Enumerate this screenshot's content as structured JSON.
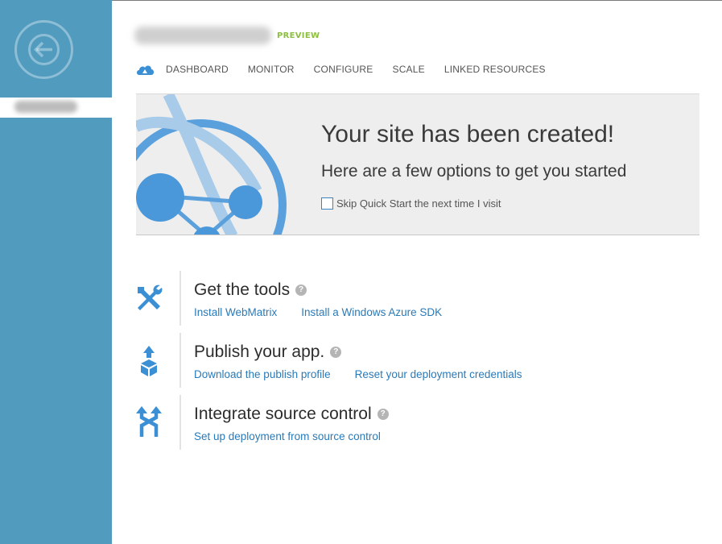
{
  "header": {
    "preview_badge": "PREVIEW"
  },
  "tabs": [
    {
      "label": "DASHBOARD"
    },
    {
      "label": "MONITOR"
    },
    {
      "label": "CONFIGURE"
    },
    {
      "label": "SCALE"
    },
    {
      "label": "LINKED RESOURCES"
    }
  ],
  "banner": {
    "title": "Your site has been created!",
    "subtitle": "Here are a few options to get you started",
    "skip_label": "Skip Quick Start the next time I visit",
    "skip_checked": false
  },
  "sections": [
    {
      "title": "Get the tools",
      "icon": "tools-icon",
      "links": [
        "Install WebMatrix",
        "Install a Windows Azure SDK"
      ]
    },
    {
      "title": "Publish your app.",
      "icon": "publish-icon",
      "links": [
        "Download the publish profile",
        "Reset your deployment credentials"
      ]
    },
    {
      "title": "Integrate source control",
      "icon": "source-control-icon",
      "links": [
        "Set up deployment from source control"
      ]
    }
  ],
  "help_glyph": "?",
  "colors": {
    "sidebar": "#519bbf",
    "accent_blue": "#2a7ab8",
    "icon_blue": "#3b8fd4",
    "preview_green": "#8cbf3f",
    "banner_bg": "#eeeeee"
  }
}
